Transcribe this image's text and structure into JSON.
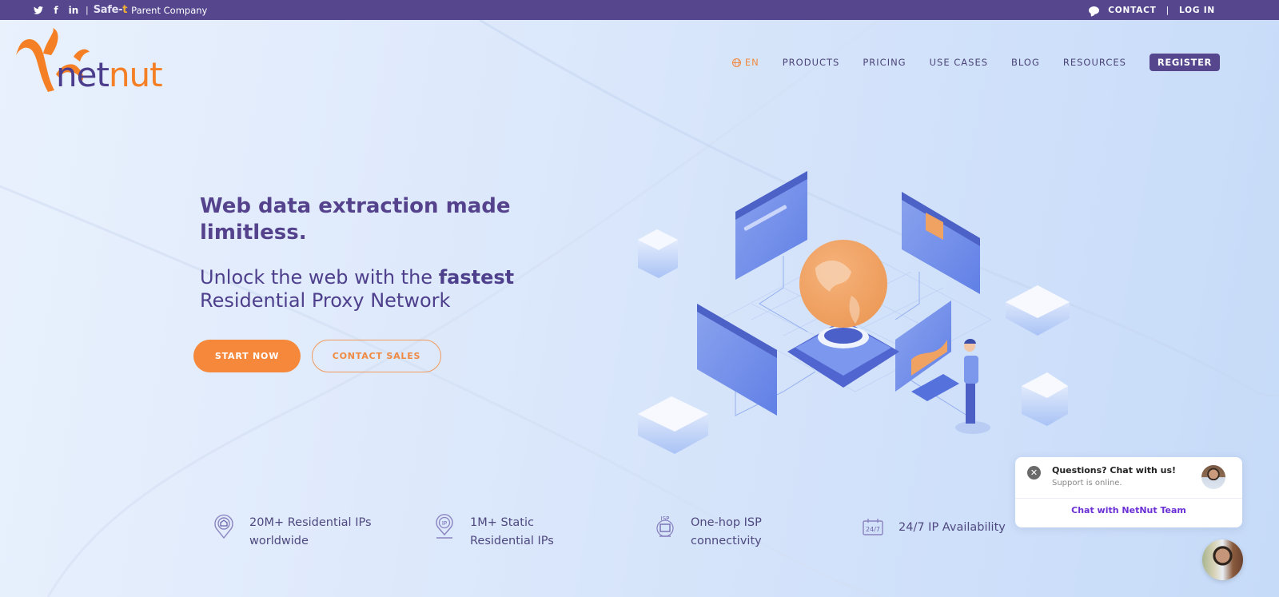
{
  "topbar": {
    "social": [
      {
        "icon": "twitter-icon",
        "glyph": "🐦"
      },
      {
        "icon": "facebook-icon",
        "glyph": "f"
      },
      {
        "icon": "linkedin-icon",
        "glyph": "in"
      }
    ],
    "separator": "|",
    "partner_brand": "Safe-",
    "partner_brand_mark": "t",
    "partner_label": "Parent Company",
    "contact_label": "CONTACT",
    "divider": "|",
    "login_label": "LOG IN"
  },
  "logo": {
    "part1": "net",
    "part2": "nut"
  },
  "nav": {
    "language": "EN",
    "items": [
      "PRODUCTS",
      "PRICING",
      "USE CASES",
      "BLOG",
      "RESOURCES"
    ],
    "register_label": "REGISTER"
  },
  "hero": {
    "title": "Web data extraction made limitless.",
    "subtitle_pre": "Unlock the web with the ",
    "subtitle_bold": "fastest",
    "subtitle_post": " Residential Proxy Network",
    "start_label": "START NOW",
    "contact_sales_label": "CONTACT SALES"
  },
  "features": [
    {
      "icon": "residential-location-icon",
      "text": "20M+ Residential IPs worldwide"
    },
    {
      "icon": "ip-location-icon",
      "text": "1M+ Static Residential IPs"
    },
    {
      "icon": "isp-monitor-icon",
      "text": "One-hop ISP connectivity"
    },
    {
      "icon": "calendar-247-icon",
      "text": "24/7 IP Availability"
    }
  ],
  "chat": {
    "close_glyph": "✕",
    "question": "Questions? Chat with us!",
    "status": "Support is online.",
    "cta": "Chat with NetNut Team"
  },
  "colors": {
    "brand_purple": "#55468e",
    "brand_orange": "#f5883a",
    "chat_link": "#6b2fd6"
  }
}
